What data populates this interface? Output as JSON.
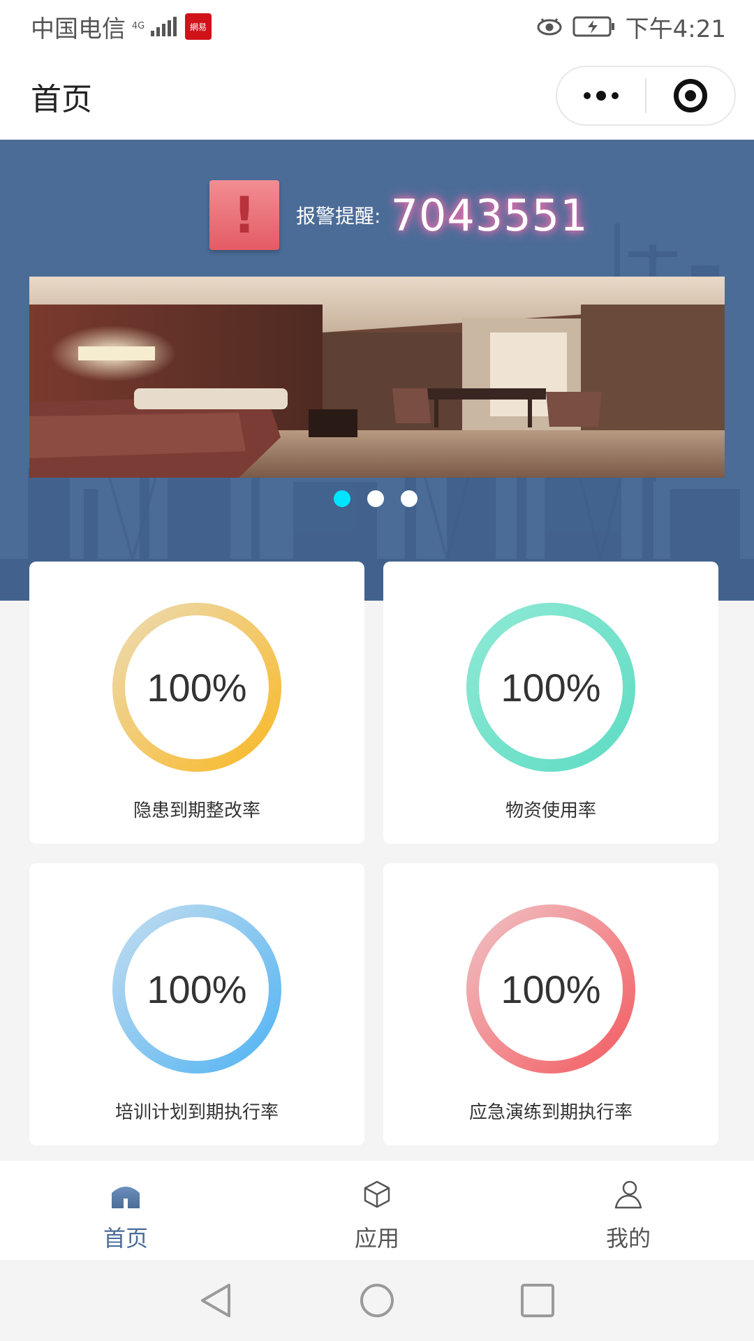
{
  "status_bar": {
    "carrier": "中国电信",
    "network": "4G",
    "badge": "網易",
    "time": "下午4:21"
  },
  "nav": {
    "title": "首页",
    "more_icon": "more-dots-icon",
    "close_icon": "target-icon"
  },
  "alert": {
    "label": "报警提醒:",
    "count": "7043551",
    "icon": "exclamation-icon",
    "icon_glyph": "!"
  },
  "carousel": {
    "slides": 3,
    "active_index": 0,
    "active_color": "#00e4ff"
  },
  "stats": [
    {
      "value": "100%",
      "label": "隐患到期整改率",
      "percent": 100,
      "color_start": "#f9b928",
      "color_end": "#ecdab0"
    },
    {
      "value": "100%",
      "label": "物资使用率",
      "percent": 100,
      "color_start": "#5fdcc4",
      "color_end": "#8ee9d4"
    },
    {
      "value": "100%",
      "label": "培训计划到期执行率",
      "percent": 100,
      "color_start": "#53b4f3",
      "color_end": "#c0dcef"
    },
    {
      "value": "100%",
      "label": "应急演练到期执行率",
      "percent": 100,
      "color_start": "#f35d62",
      "color_end": "#f0c0c3"
    }
  ],
  "tabs": [
    {
      "label": "首页",
      "icon": "home-icon",
      "active": true
    },
    {
      "label": "应用",
      "icon": "cube-icon",
      "active": false
    },
    {
      "label": "我的",
      "icon": "user-icon",
      "active": false
    }
  ],
  "system_nav": {
    "back": "back-triangle-icon",
    "home": "home-circle-icon",
    "recent": "recent-square-icon"
  },
  "colors": {
    "hero_bg": "#4b6c97",
    "active_tab": "#4b6c97",
    "alert_glow": "#ff6fb0"
  }
}
